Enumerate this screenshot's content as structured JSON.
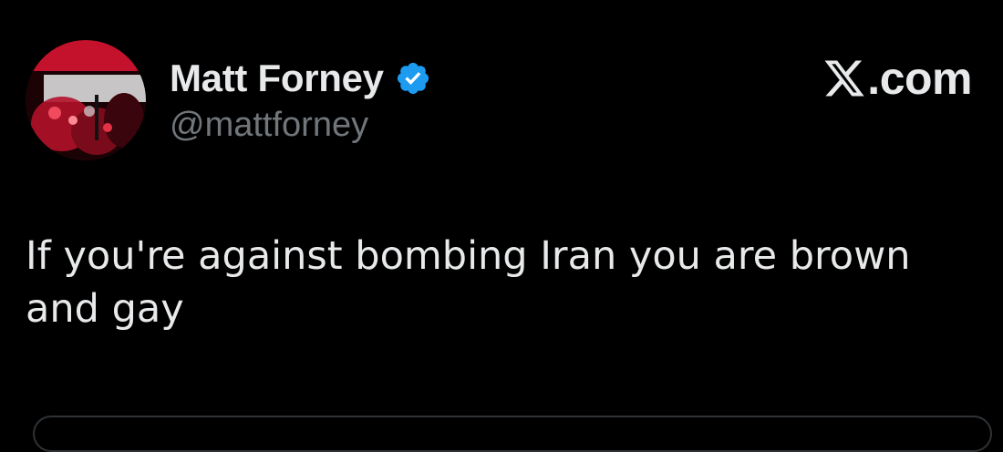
{
  "author": {
    "display_name": "Matt Forney",
    "handle": "@mattforney",
    "verified": true,
    "avatar_icon": "profile-photo"
  },
  "brand": {
    "text": ".com",
    "logo_icon": "x-logo-icon"
  },
  "tweet": {
    "text": "If you're against bombing Iran you are brown and gay"
  },
  "colors": {
    "background": "#000000",
    "primary_text": "#e7e9ea",
    "secondary_text": "#71767b",
    "verified_blue": "#1d9bf0",
    "border": "#2f3336"
  }
}
